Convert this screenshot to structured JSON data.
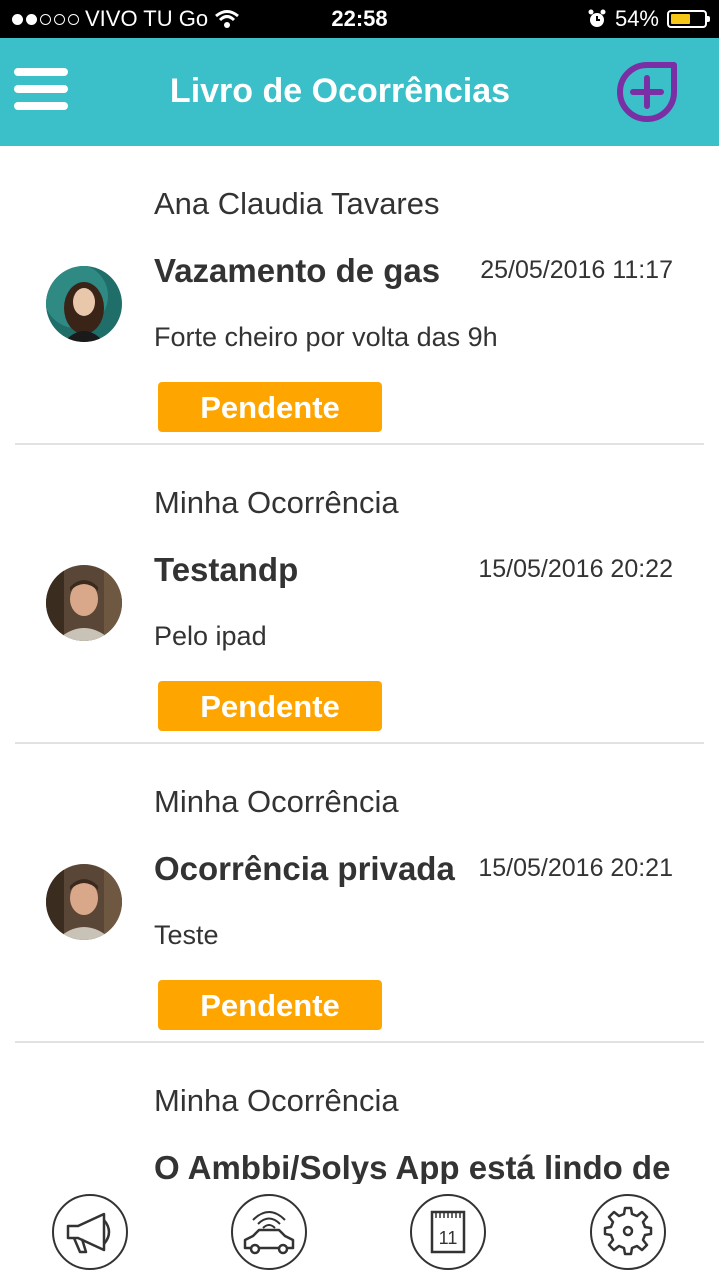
{
  "status_bar": {
    "carrier": "VIVO TU Go",
    "time": "22:58",
    "battery": "54%",
    "battery_level": 0.54
  },
  "header": {
    "title": "Livro de Ocorrências",
    "menu_icon": "hamburger-menu-icon",
    "add_icon": "add-circle-icon"
  },
  "colors": {
    "header": "#3bbfc8",
    "badge": "#ffa500",
    "add_icon": "#7a2fa5"
  },
  "occurrences": [
    {
      "author": "Ana Claudia Tavares",
      "subject": "Vazamento de gas",
      "date": "25/05/2016 11:17",
      "description": "Forte cheiro por volta das 9h",
      "status": "Pendente"
    },
    {
      "author": "Minha Ocorrência",
      "subject": "Testandp",
      "date": "15/05/2016 20:22",
      "description": "Pelo ipad",
      "status": "Pendente"
    },
    {
      "author": "Minha Ocorrência",
      "subject": "Ocorrência privada",
      "date": "15/05/2016 20:21",
      "description": "Teste",
      "status": "Pendente"
    },
    {
      "author": "Minha Ocorrência",
      "subject": "O Ambbi/Solys App está lindo de"
    }
  ],
  "tabbar": {
    "tabs": [
      "megaphone-icon",
      "car-wifi-icon",
      "calendar-icon",
      "gear-icon"
    ],
    "calendar_day": "11"
  }
}
